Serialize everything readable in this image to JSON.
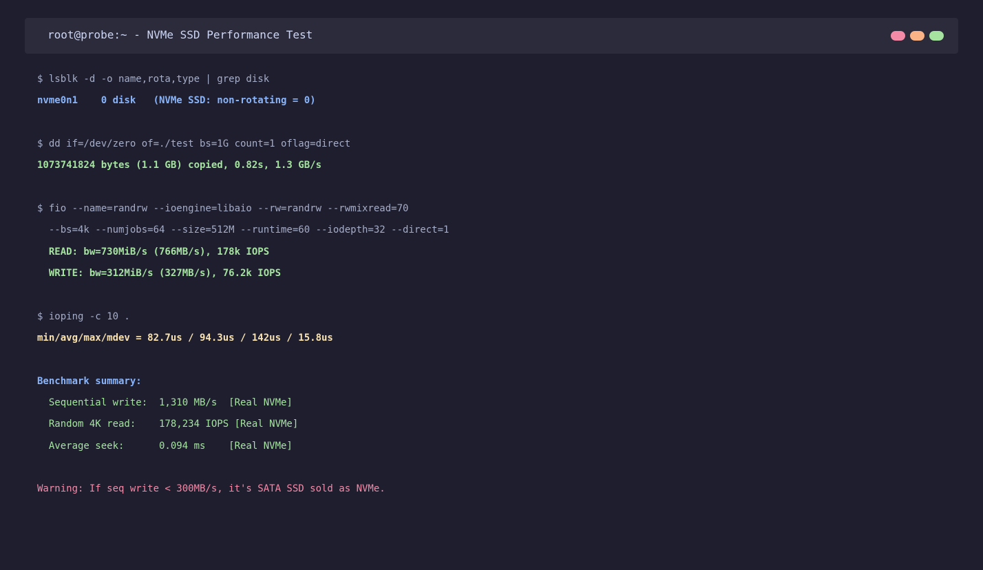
{
  "window": {
    "title": "root@probe:~ - NVMe SSD Performance Test"
  },
  "colors": {
    "background": "#1e1e2e",
    "titlebar": "#2b2b3c",
    "command": "#a6adc8",
    "info": "#89b4fa",
    "success": "#a6e3a1",
    "latency": "#f9e2af",
    "warning": "#f38ba8",
    "dot_red": "#f38ba8",
    "dot_yellow": "#fab387",
    "dot_green": "#a6e3a1"
  },
  "terminal": {
    "lsblk": {
      "command": "$ lsblk -d -o name,rota,type | grep disk",
      "output": "nvme0n1    0 disk   (NVMe SSD: non-rotating = 0)"
    },
    "dd": {
      "command": "$ dd if=/dev/zero of=./test bs=1G count=1 oflag=direct",
      "output": "1073741824 bytes (1.1 GB) copied, 0.82s, 1.3 GB/s"
    },
    "fio": {
      "command": "$ fio --name=randrw --ioengine=libaio --rw=randrw --rwmixread=70",
      "command_cont": "  --bs=4k --numjobs=64 --size=512M --runtime=60 --iodepth=32 --direct=1",
      "read": "  READ: bw=730MiB/s (766MB/s), 178k IOPS",
      "write": "  WRITE: bw=312MiB/s (327MB/s), 76.2k IOPS"
    },
    "ioping": {
      "command": "$ ioping -c 10 .",
      "output": "min/avg/max/mdev = 82.7us / 94.3us / 142us / 15.8us"
    },
    "summary": {
      "heading": "Benchmark summary:",
      "seq_write": "  Sequential write:  1,310 MB/s  [Real NVMe]",
      "rand_read": "  Random 4K read:    178,234 IOPS [Real NVMe]",
      "avg_seek": "  Average seek:      0.094 ms    [Real NVMe]"
    },
    "warning": "Warning: If seq write < 300MB/s, it's SATA SSD sold as NVMe."
  }
}
